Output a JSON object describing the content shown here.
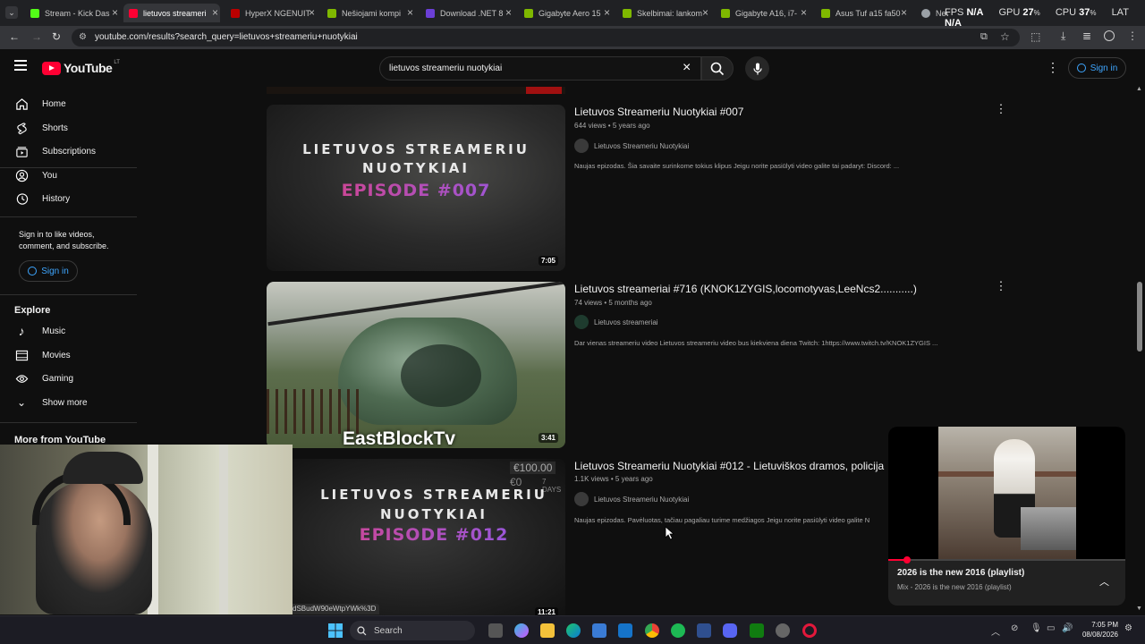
{
  "browser": {
    "tabs": [
      {
        "title": "Stream - Kick Das",
        "color": "#53fc18"
      },
      {
        "title": "lietuvos streameri",
        "color": "#ff0033"
      },
      {
        "title": "HyperX NGENUIT",
        "color": "#c00"
      },
      {
        "title": "Nešiojami kompi",
        "color": "#7fb800"
      },
      {
        "title": "Download .NET 8",
        "color": "#6b3fd6"
      },
      {
        "title": "Gigabyte Aero 15",
        "color": "#7fb800"
      },
      {
        "title": "Skelbimai: lankom",
        "color": "#7fb800"
      },
      {
        "title": "Gigabyte A16, i7-",
        "color": "#7fb800"
      },
      {
        "title": "Asus Tuf a15 fa50",
        "color": "#7fb800"
      },
      {
        "title": "New Tab",
        "color": "#9aa0a6"
      }
    ],
    "url": "youtube.com/results?search_query=lietuvos+streameriu+nuotykiai"
  },
  "overlay": {
    "fps_label": "FPS",
    "fps_value": "N/A",
    "gpu_label": "GPU",
    "gpu_value": "27",
    "cpu_label": "CPU",
    "cpu_value": "37",
    "lat_label": "LAT",
    "lat_value": "N/A"
  },
  "youtube": {
    "logo_text": "YouTube",
    "region": "LT",
    "search_query": "lietuvos streameriu nuotykiai",
    "signin_label": "Sign in"
  },
  "sidebar": {
    "items": [
      {
        "label": "Home",
        "icon": "home-icon"
      },
      {
        "label": "Shorts",
        "icon": "shorts-icon"
      },
      {
        "label": "Subscriptions",
        "icon": "subscriptions-icon"
      },
      {
        "label": "You",
        "icon": "you-icon"
      },
      {
        "label": "History",
        "icon": "history-icon"
      }
    ],
    "signin_prompt": "Sign in to like videos, comment, and subscribe.",
    "signin_label": "Sign in",
    "explore_heading": "Explore",
    "explore_items": [
      {
        "label": "Music",
        "icon": "music-icon"
      },
      {
        "label": "Movies",
        "icon": "movies-icon"
      },
      {
        "label": "Gaming",
        "icon": "gaming-icon"
      },
      {
        "label": "Show more",
        "icon": "chevron-down-icon"
      }
    ],
    "more_heading": "More from YouTube"
  },
  "results": [
    {
      "title": "Lietuvos Streameriu Nuotykiai #007",
      "meta": "644 views • 5 years ago",
      "channel": "Lietuvos Streameriu Nuotykiai",
      "description": "Naujas epizodas. Šia savaite surinkome tokius klipus Jeigu norite pasiūlyti video galite tai padaryt: Discord: ...",
      "duration": "7:05",
      "thumb_line1": "LIETUVOS STREAMERIU",
      "thumb_line2": "NUOTYKIAI",
      "thumb_line3": "EPISODE #007"
    },
    {
      "title": "Lietuvos streameriai #716 (KNOK1ZYGIS,locomotyvas,LeeNcs2...........)",
      "meta": "74 views • 5 months ago",
      "channel": "Lietuvos streameriai",
      "description": "Dar vienas streameriu video Lietuvos streameriu video bus kiekviena diena Twitch: 1https://www.twitch.tv/KNOK1ZYGIS ...",
      "duration": "3:41",
      "thumb_caption": "EastBlockTv"
    },
    {
      "title": "Lietuvos Streameriu Nuotykiai #012 - Lietuviškos dramos, policija",
      "meta": "1.1K views • 5 years ago",
      "channel": "Lietuvos Streameriu Nuotykiai",
      "description": "Naujas epizodas. Pavėluotas, tačiau pagaliau turime medžiagos Jeigu norite pasiūlyti video galite N",
      "duration": "11:21",
      "thumb_line1": "LIETUVOS STREAMERIU",
      "thumb_line2": "NUOTYKIAI",
      "thumb_line3": "EPISODE #012",
      "thumb_price": "€100.00",
      "thumb_price2": "€0",
      "thumb_days": "7 DAYS"
    }
  ],
  "status_url": "dSBudW90eWtpYWk%3D",
  "miniplayer": {
    "title": "2026 is the new 2016 (playlist)",
    "subtitle": "Mix - 2026 is the new 2016 (playlist)",
    "progress": 0.08
  },
  "taskbar": {
    "search_label": "Search",
    "time": "7:05 PM",
    "date": "08/08/2026"
  }
}
